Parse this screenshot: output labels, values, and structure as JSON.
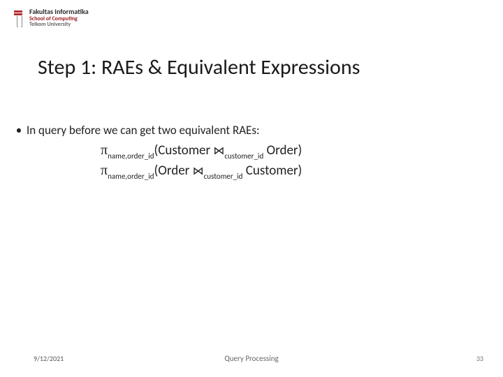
{
  "logo": {
    "line1": "Fakultas Informatika",
    "line2": "School of Computing",
    "line3": "Telkom University"
  },
  "title": "Step 1: RAEs & Equivalent Expressions",
  "bullet_text": "In query before we can get two equivalent RAEs:",
  "expr1": {
    "pi": "π",
    "sub1": "name,order_id",
    "open": "(Customer ",
    "join": "⋈",
    "sub2": "customer_id",
    "rest": " Order)"
  },
  "expr2": {
    "pi": "π",
    "sub1": "name,order_id",
    "open": "(Order ",
    "join": "⋈",
    "sub2": "customer_id",
    "rest": " Customer)"
  },
  "footer": {
    "date": "9/12/2021",
    "center": "Query Processing",
    "page": "33"
  }
}
